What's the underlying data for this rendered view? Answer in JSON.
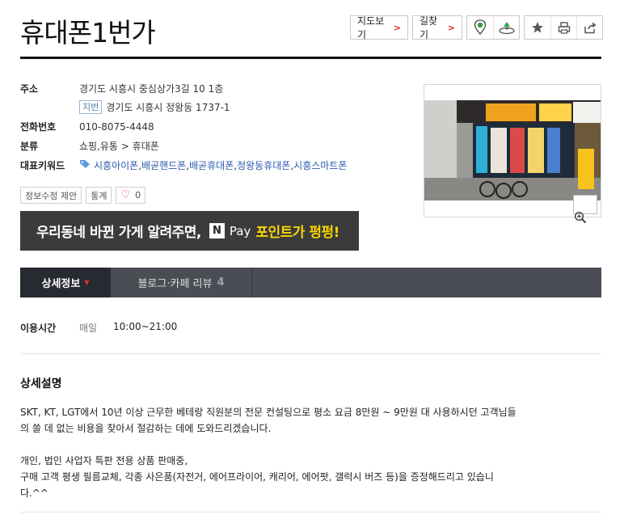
{
  "place": {
    "title": "휴대폰1번가"
  },
  "actions": {
    "map_label": "지도보기",
    "route_label": "길찾기",
    "chevron": ">"
  },
  "info": {
    "address_label": "주소",
    "address": "경기도 시흥시 중심상가3길 10 1층",
    "jibun_badge": "지번",
    "jibun_address": "경기도 시흥시 정왕동 1737-1",
    "phone_label": "전화번호",
    "phone": "010-8075-4448",
    "category_label": "분류",
    "category": "쇼핑,유통 > 휴대폰",
    "keyword_label": "대표키워드",
    "keywords": [
      "시흥아이폰",
      "배곧핸드폰",
      "배곧휴대폰",
      "정왕동휴대폰",
      "시흥스마트폰"
    ],
    "keyword_sep": ", "
  },
  "minibuttons": {
    "suggest": "정보수정 제안",
    "stats": "통계",
    "likes": "0"
  },
  "banner": {
    "text1": "우리동네 바뀐 가게 알려주면,",
    "n": "N",
    "pay": "Pay",
    "text2": "포인트가 펑펑!"
  },
  "tabs": [
    {
      "label": "상세정보",
      "active": true
    },
    {
      "label": "블로그·카페 리뷰",
      "count": "4"
    }
  ],
  "hours": {
    "label": "이용시간",
    "day": "매일",
    "time": "10:00~21:00"
  },
  "detail": {
    "heading": "상세설명",
    "para1": "SKT, KT, LGT에서 10년 이상 근무한 베테랑 직원분의 전문 컨설팅으로 평소 요금 8만원 ~ 9만원 대 사용하시던 고객님들\n의 쓸 데 없는 비용을 찾아서 절감하는 데에 도와드리겠습니다.",
    "para2": "개인, 법인 사업자 특판 전용 상품 판매중,\n구매 고객 평생 필름교체, 각종 사은품(자전거, 에어프라이어, 캐리어, 에어팟, 갤럭시 버즈 등)을 증정해드리고 있습니\n다.^^"
  },
  "colors": {
    "accent_red": "#d1241c",
    "keyword_blue": "#2c59b2",
    "banner_yellow": "#f7d500",
    "tab_bg": "#4a4d54"
  },
  "icons": [
    "chevron-right-icon",
    "map-pin-icon",
    "street-view-icon",
    "star-icon",
    "print-icon",
    "share-icon",
    "tag-icon",
    "heart-icon",
    "zoom-in-icon"
  ]
}
